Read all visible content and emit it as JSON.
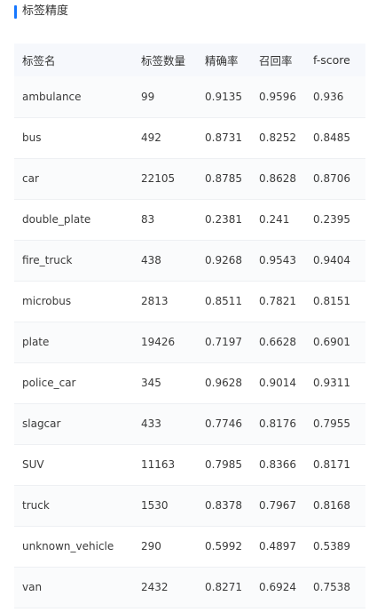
{
  "section": {
    "title": "标签精度",
    "accent_color": "#1677ff"
  },
  "table": {
    "headers": [
      "标签名",
      "标签数量",
      "精确率",
      "召回率",
      "f-score"
    ],
    "rows": [
      [
        "ambulance",
        "99",
        "0.9135",
        "0.9596",
        "0.936"
      ],
      [
        "bus",
        "492",
        "0.8731",
        "0.8252",
        "0.8485"
      ],
      [
        "car",
        "22105",
        "0.8785",
        "0.8628",
        "0.8706"
      ],
      [
        "double_plate",
        "83",
        "0.2381",
        "0.241",
        "0.2395"
      ],
      [
        "fire_truck",
        "438",
        "0.9268",
        "0.9543",
        "0.9404"
      ],
      [
        "microbus",
        "2813",
        "0.8511",
        "0.7821",
        "0.8151"
      ],
      [
        "plate",
        "19426",
        "0.7197",
        "0.6628",
        "0.6901"
      ],
      [
        "police_car",
        "345",
        "0.9628",
        "0.9014",
        "0.9311"
      ],
      [
        "slagcar",
        "433",
        "0.7746",
        "0.8176",
        "0.7955"
      ],
      [
        "SUV",
        "11163",
        "0.7985",
        "0.8366",
        "0.8171"
      ],
      [
        "truck",
        "1530",
        "0.8378",
        "0.7967",
        "0.8168"
      ],
      [
        "unknown_vehicle",
        "290",
        "0.5992",
        "0.4897",
        "0.5389"
      ],
      [
        "van",
        "2432",
        "0.8271",
        "0.6924",
        "0.7538"
      ]
    ]
  }
}
